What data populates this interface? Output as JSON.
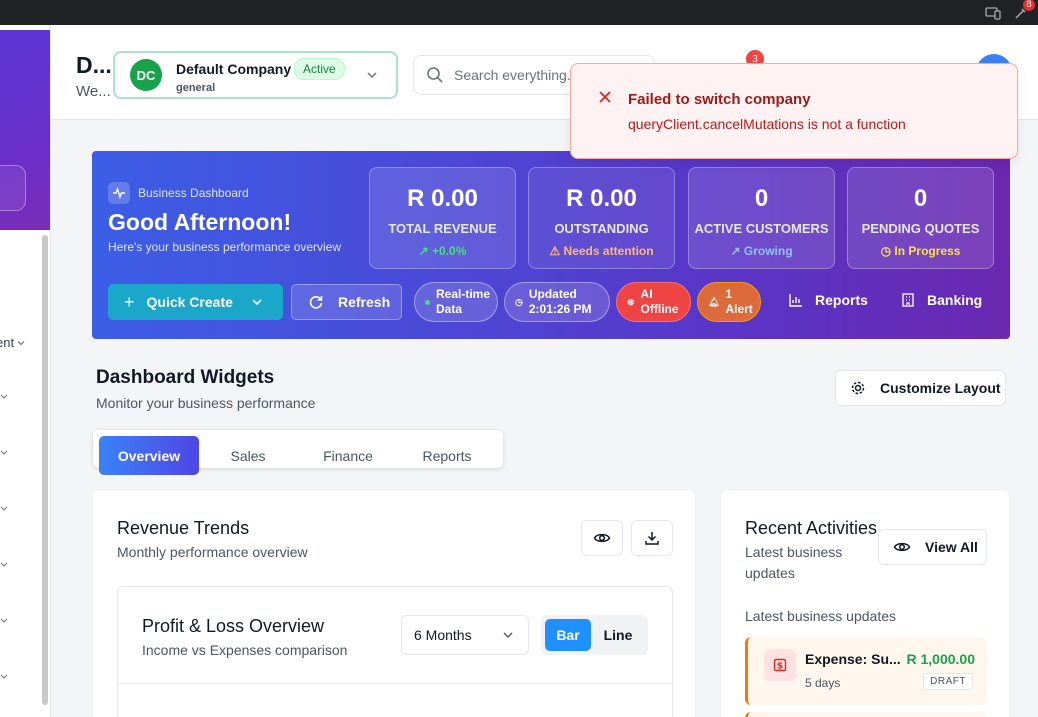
{
  "topbar": {
    "badge": "8"
  },
  "sidebar": {
    "partial_label": "ent"
  },
  "header": {
    "title": "D...",
    "subtitle": "We...",
    "company": {
      "initials": "DC",
      "name": "Default Company",
      "type": "general",
      "status": "Active"
    },
    "search_placeholder": "Search everything...",
    "notification_count": "3"
  },
  "toast": {
    "title": "Failed to switch company",
    "message": "queryClient.cancelMutations is not a function"
  },
  "hero": {
    "badge": "Business Dashboard",
    "greeting": "Good Afternoon!",
    "subtitle": "Here's your business performance overview",
    "stats": [
      {
        "value": "R 0.00",
        "label": "TOTAL REVENUE",
        "sub": "+0.0%",
        "sub_color": "#4ade80",
        "icon": "trend-up-icon"
      },
      {
        "value": "R 0.00",
        "label": "OUTSTANDING",
        "sub": "Needs attention",
        "sub_color": "#fdba74",
        "icon": "warning-icon"
      },
      {
        "value": "0",
        "label": "ACTIVE CUSTOMERS",
        "sub": "Growing",
        "sub_color": "#93c5fd",
        "icon": "trend-icon"
      },
      {
        "value": "0",
        "label": "PENDING QUOTES",
        "sub": "In Progress",
        "sub_color": "#fde047",
        "icon": "clock-icon"
      }
    ],
    "quick_create": "Quick Create",
    "refresh": "Refresh",
    "pills": {
      "realtime_1": "Real-time",
      "realtime_2": "Data",
      "updated_1": "Updated",
      "updated_2": "2:01:26 PM",
      "ai_1": "AI",
      "ai_2": "Offline",
      "alert_1": "1",
      "alert_2": "Alert"
    },
    "reports": "Reports",
    "banking": "Banking"
  },
  "widgets": {
    "title": "Dashboard Widgets",
    "subtitle": "Monitor your business performance",
    "customize": "Customize Layout",
    "tabs": [
      "Overview",
      "Sales",
      "Finance",
      "Reports"
    ]
  },
  "revenue": {
    "title": "Revenue Trends",
    "subtitle": "Monthly performance overview",
    "pl_title": "Profit & Loss Overview",
    "pl_subtitle": "Income vs Expenses comparison",
    "period": "6 Months",
    "bar": "Bar",
    "line": "Line"
  },
  "activities": {
    "title": "Recent Activities",
    "subtitle_1": "Latest business",
    "subtitle_2": "updates",
    "view_all": "View All",
    "label": "Latest business updates",
    "items": [
      {
        "title": "Expense: Su...",
        "time": "5 days",
        "amount": "R 1,000.00",
        "status": "DRAFT"
      }
    ]
  },
  "colors": {
    "accent": "#4f46e5",
    "success": "#16a34a",
    "danger": "#dc2626",
    "hero_start": "#3b5ee6",
    "hero_end": "#6a28b0"
  }
}
